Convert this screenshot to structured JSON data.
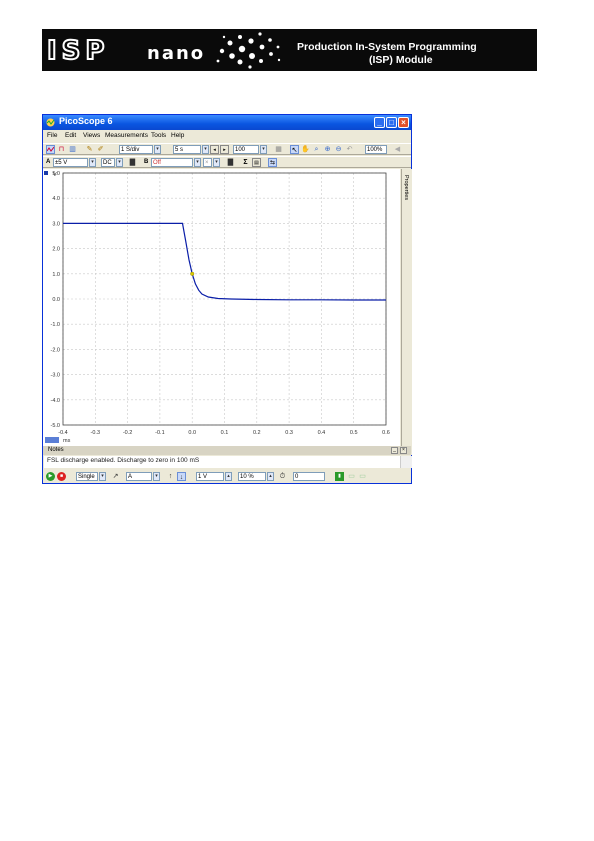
{
  "banner": {
    "brand_main": "ISP",
    "brand_sub": "nano",
    "tagline_1": "Production In-System Programming",
    "tagline_2": "(ISP) Module"
  },
  "window": {
    "title": "PicoScope 6",
    "menu": [
      "File",
      "Edit",
      "Views",
      "Measurements",
      "Tools",
      "Help"
    ],
    "toolbar1": {
      "samples": "1 S/div",
      "timebase": "5 s",
      "resolution": "100",
      "zoom": "100%"
    },
    "toolbar2": {
      "channel": "A",
      "range": "±5 V",
      "coupling": "DC",
      "channel_b": "B",
      "channel_b_state": "Off"
    },
    "right_tab": "Properties",
    "notes": {
      "header": "Notes",
      "text": "FSL discharge enabled. Discharge to zero in 100 mS"
    },
    "statusbar": {
      "trigger_mode": "Single",
      "trigger_channel": "A",
      "threshold": "1 V",
      "pretrigger": "10 %",
      "delay": "0"
    }
  },
  "chart_data": {
    "type": "line",
    "title": "",
    "xlabel": "",
    "ylabel": "",
    "x_unit": "ms",
    "y_unit": "V",
    "x_ticks": [
      "-0.4",
      "-0.3",
      "-0.2",
      "-0.1",
      "0.0",
      "0.1",
      "0.2",
      "0.3",
      "0.4",
      "0.5",
      "0.6"
    ],
    "y_ticks": [
      "5.0",
      "4.0",
      "3.0",
      "2.0",
      "1.0",
      "0.0",
      "-1.0",
      "-2.0",
      "-3.0",
      "-4.0",
      "-5.0"
    ],
    "xlim": [
      -0.4,
      0.6
    ],
    "ylim": [
      -5,
      5
    ],
    "grid": true,
    "colors": {
      "series": "#0a1ea8",
      "trigger": "#d8c800"
    },
    "series": [
      {
        "x": [
          -0.4,
          -0.3,
          -0.2,
          -0.1,
          -0.03,
          -0.02,
          -0.01,
          0.0,
          0.01,
          0.02,
          0.03,
          0.05,
          0.08,
          0.12,
          0.2,
          0.3,
          0.4,
          0.5,
          0.6
        ],
        "y": [
          3.0,
          3.0,
          3.0,
          3.0,
          3.0,
          2.3,
          1.55,
          1.0,
          0.6,
          0.35,
          0.2,
          0.08,
          0.02,
          0.0,
          -0.02,
          -0.03,
          -0.03,
          -0.04,
          -0.04
        ]
      }
    ],
    "trigger_marker": {
      "x": 0.0,
      "y": 1.0
    }
  }
}
